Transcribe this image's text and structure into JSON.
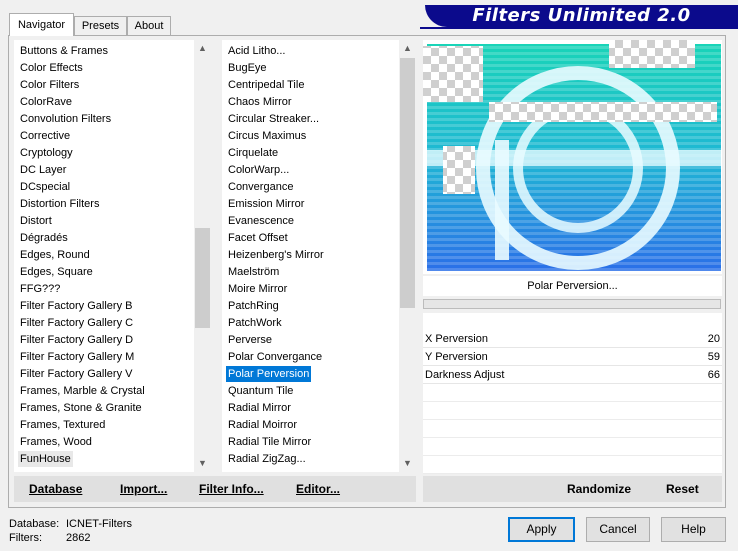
{
  "tabs": [
    {
      "label": "Navigator",
      "active": true
    },
    {
      "label": "Presets",
      "active": false
    },
    {
      "label": "About",
      "active": false
    }
  ],
  "title": "Filters Unlimited 2.0",
  "categories": [
    "Buttons & Frames",
    "Color Effects",
    "Color Filters",
    "ColorRave",
    "Convolution Filters",
    "Corrective",
    "Cryptology",
    "DC Layer",
    "DCspecial",
    "Distortion Filters",
    "Distort",
    "Dégradés",
    "Edges, Round",
    "Edges, Square",
    "FFG???",
    "Filter Factory Gallery B",
    "Filter Factory Gallery C",
    "Filter Factory Gallery D",
    "Filter Factory Gallery M",
    "Filter Factory Gallery V",
    "Frames, Marble & Crystal",
    "Frames, Stone & Granite",
    "Frames, Textured",
    "Frames, Wood",
    "FunHouse"
  ],
  "selected_category": "FunHouse",
  "filters": [
    "Acid Litho...",
    "BugEye",
    "Centripedal Tile",
    "Chaos Mirror",
    "Circular Streaker...",
    "Circus Maximus",
    "Cirquelate",
    "ColorWarp...",
    "Convergance",
    "Emission Mirror",
    "Evanescence",
    "Facet Offset",
    "Heizenberg's Mirror",
    "Maelström",
    "Moire Mirror",
    "PatchRing",
    "PatchWork",
    "Perverse",
    "Polar Convergance",
    "Polar Perversion",
    "Quantum Tile",
    "Radial Mirror",
    "Radial Moirror",
    "Radial Tile Mirror",
    "Radial ZigZag..."
  ],
  "selected_filter": "Polar Perversion",
  "filter_name": "Polar Perversion...",
  "params": [
    {
      "label": "X Perversion",
      "value": 20
    },
    {
      "label": "Y Perversion",
      "value": 59
    },
    {
      "label": "Darkness Adjust",
      "value": 66
    }
  ],
  "toolbar": {
    "database": "Database",
    "import": "Import...",
    "filter_info": "Filter Info...",
    "editor": "Editor...",
    "randomize": "Randomize",
    "reset": "Reset"
  },
  "status": {
    "database_label": "Database:",
    "database_value": "ICNET-Filters",
    "filters_label": "Filters:",
    "filters_value": "2862"
  },
  "buttons": {
    "apply": "Apply",
    "cancel": "Cancel",
    "help": "Help"
  },
  "colors": {
    "title_bg": "#0b0a8c",
    "selection": "#0078d7",
    "preview_teal": "#19d4b8",
    "preview_blue": "#2a6fe8"
  }
}
